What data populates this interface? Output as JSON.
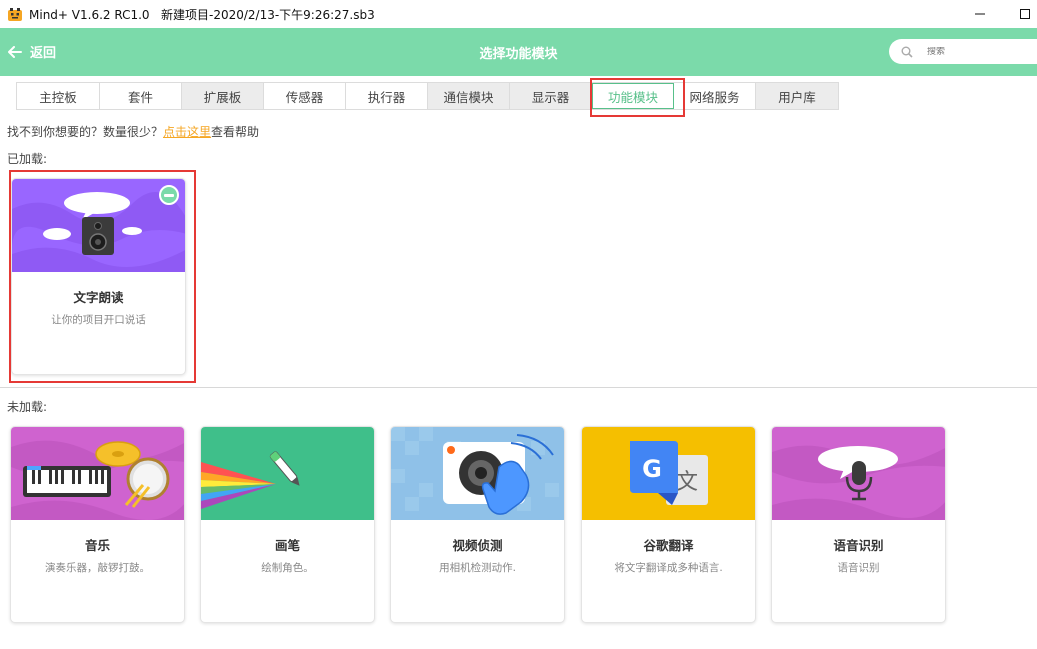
{
  "window": {
    "title": "Mind+ V1.6.2 RC1.0   新建项目-2020/2/13-下午9:26:27.sb3"
  },
  "header": {
    "back_label": "返回",
    "title": "选择功能模块",
    "search_placeholder": "搜索"
  },
  "tabs": [
    {
      "label": "主控板"
    },
    {
      "label": "套件"
    },
    {
      "label": "扩展板"
    },
    {
      "label": "传感器"
    },
    {
      "label": "执行器"
    },
    {
      "label": "通信模块"
    },
    {
      "label": "显示器"
    },
    {
      "label": "功能模块"
    },
    {
      "label": "网络服务"
    },
    {
      "label": "用户库"
    }
  ],
  "help": {
    "prefix": "找不到你想要的？数量很少？",
    "link": "点击这里",
    "suffix": "查看帮助"
  },
  "loaded": {
    "label": "已加载:",
    "cards": [
      {
        "name": "文字朗读",
        "desc": "让你的项目开口说话"
      }
    ]
  },
  "unloaded": {
    "label": "未加载:",
    "cards": [
      {
        "name": "音乐",
        "desc": "演奏乐器，敲锣打鼓。"
      },
      {
        "name": "画笔",
        "desc": "绘制角色。"
      },
      {
        "name": "视频侦测",
        "desc": "用相机检测动作."
      },
      {
        "name": "谷歌翻译",
        "desc": "将文字翻译成多种语言."
      },
      {
        "name": "语音识别",
        "desc": "语音识别"
      }
    ]
  },
  "colors": {
    "accent": "#7bdaaa",
    "active_tab": "#58c08a",
    "highlight": "#e53935",
    "link": "#f5a623",
    "purple_cover": "#9966ff",
    "music_cover": "#cf63cf",
    "pen_cover": "#3fbf8a",
    "video_cover": "#8fc1e8",
    "translate_cover": "#f5bf00",
    "speech_cover": "#cf63cf"
  }
}
